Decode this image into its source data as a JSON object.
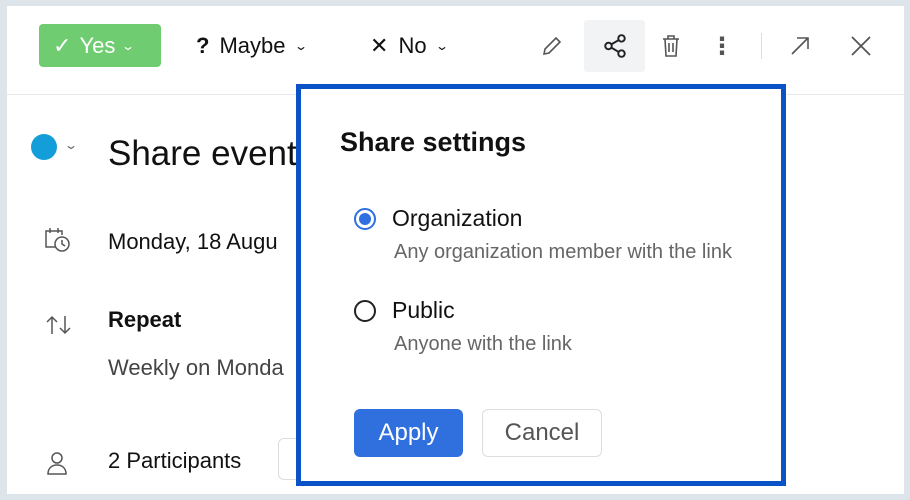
{
  "toolbar": {
    "yes": "Yes",
    "maybe": "Maybe",
    "no": "No",
    "yes_color": "#6fcc71"
  },
  "event": {
    "title": "Share event",
    "date": "Monday, 18 Augu",
    "repeat_label": "Repeat",
    "repeat_value": "Weekly on Monda",
    "participants": "2 Participants",
    "color": "#139ed9"
  },
  "share": {
    "title": "Share settings",
    "options": [
      {
        "label": "Organization",
        "description": "Any organization member with the link",
        "selected": true
      },
      {
        "label": "Public",
        "description": "Anyone with the link",
        "selected": false
      }
    ],
    "apply": "Apply",
    "cancel": "Cancel",
    "border_color": "#0a52c8"
  }
}
